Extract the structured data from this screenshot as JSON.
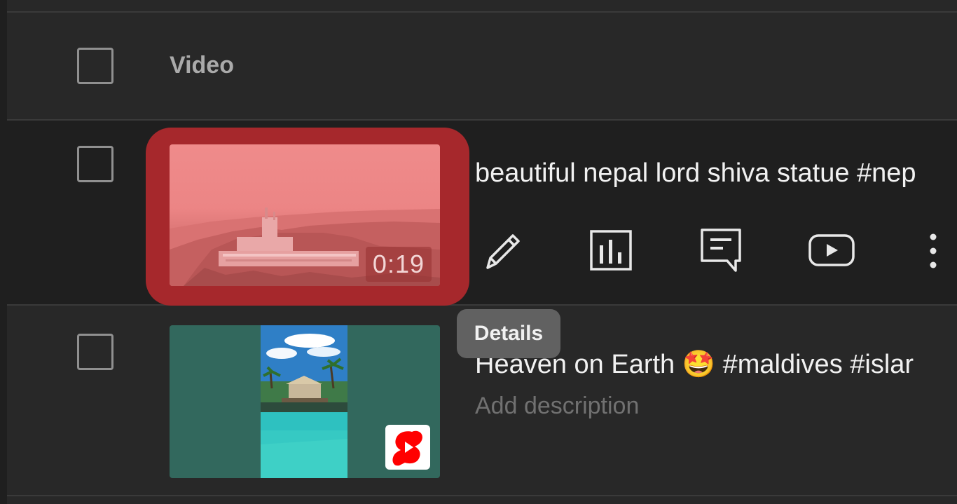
{
  "table": {
    "header_label": "Video"
  },
  "rows": [
    {
      "title": "beautiful nepal lord shiva statue #nep",
      "duration": "0:19",
      "actions": [
        {
          "name": "details",
          "icon": "pencil-icon"
        },
        {
          "name": "analytics",
          "icon": "bar-chart-icon"
        },
        {
          "name": "comments",
          "icon": "comment-icon"
        },
        {
          "name": "view-on-youtube",
          "icon": "play-icon"
        },
        {
          "name": "options",
          "icon": "more-vertical-icon"
        }
      ]
    },
    {
      "title": "Heaven on Earth 🤩 #maldives #islar",
      "description": "Add description",
      "badge_icon": "shorts-icon"
    }
  ],
  "tooltip": {
    "text": "Details"
  },
  "colors": {
    "background": "#282828",
    "selected_row": "#1f1f1f",
    "highlight": "#a6282c",
    "tooltip": "#616161",
    "shorts_red": "#ff0000"
  }
}
